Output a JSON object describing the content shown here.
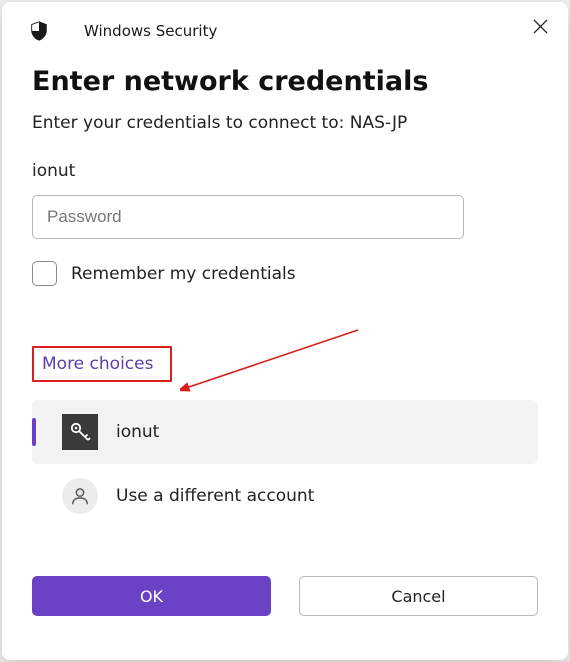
{
  "titlebar": {
    "app_name": "Windows Security"
  },
  "dialog": {
    "heading": "Enter network credentials",
    "subtext": "Enter your credentials to connect to: NAS-JP",
    "username": "ionut",
    "password_placeholder": "Password",
    "remember_label": "Remember my credentials",
    "more_choices_label": "More choices"
  },
  "accounts": [
    {
      "label": "ionut",
      "icon": "key",
      "selected": true
    },
    {
      "label": "Use a different account",
      "icon": "person",
      "selected": false
    }
  ],
  "buttons": {
    "ok": "OK",
    "cancel": "Cancel"
  },
  "colors": {
    "accent": "#6942c5",
    "highlight_border": "#d81e1e"
  }
}
